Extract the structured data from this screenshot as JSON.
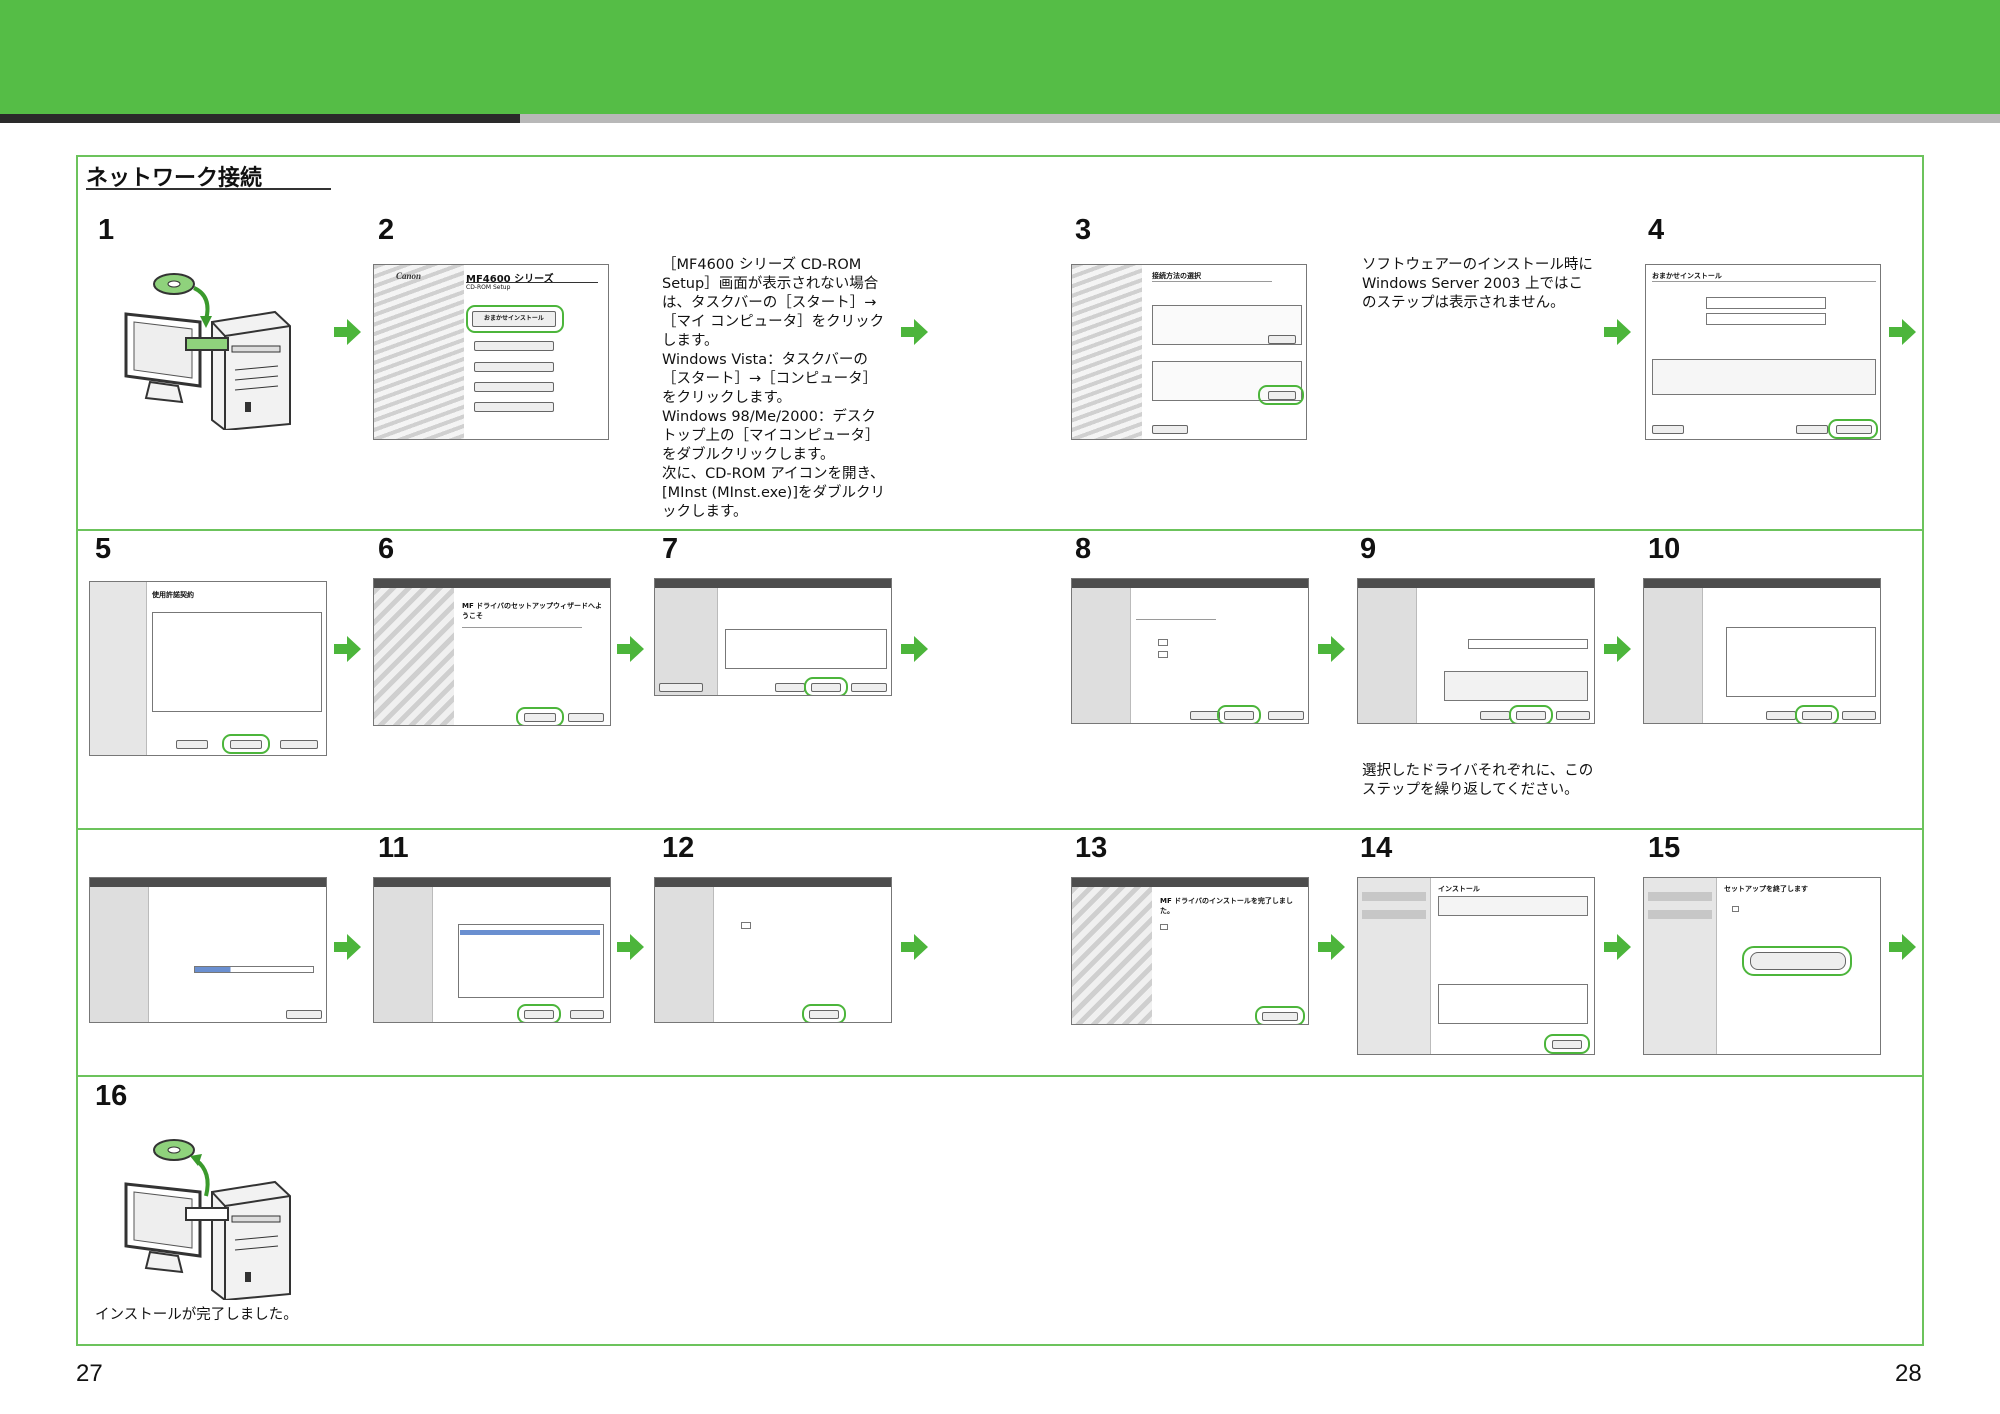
{
  "header": {
    "accent_color": "#55bd46",
    "frame_color": "#6cc35c"
  },
  "section": {
    "title": "ネットワーク接続"
  },
  "steps": [
    {
      "number": "1"
    },
    {
      "number": "2"
    },
    {
      "number": "3"
    },
    {
      "number": "4"
    },
    {
      "number": "5"
    },
    {
      "number": "6"
    },
    {
      "number": "7"
    },
    {
      "number": "8"
    },
    {
      "number": "9"
    },
    {
      "number": "10"
    },
    {
      "number": "11"
    },
    {
      "number": "12"
    },
    {
      "number": "13"
    },
    {
      "number": "14"
    },
    {
      "number": "15"
    },
    {
      "number": "16"
    }
  ],
  "notes": {
    "step2": "［MF4600 シリーズ CD-ROM Setup］画面が表示されない場合は、タスクバーの［スタート］→［マイ コンピュータ］をクリックします。\nWindows Vista：タスクバーの［スタート］→［コンピュータ］をクリックします。\nWindows 98/Me/2000：デスクトップ上の［マイコンピュータ］をダブルクリックします。\n次に、CD-ROM アイコンを開き、[MInst (MInst.exe)]をダブルクリックします。",
    "step3": "ソフトウェアーのインストール時に Windows Server 2003 上ではこのステップは表示されません。",
    "step9": "選択したドライバそれぞれに、このステップを繰り返してください。",
    "step16": "インストールが完了しました。"
  },
  "screens": {
    "step2": {
      "brand": "Canon",
      "title": "MF4600 シリーズ",
      "subtitle": "CD-ROM Setup",
      "main_button": "おまかせインストール"
    },
    "step3": {
      "title": "接続方法の選択"
    },
    "step4": {
      "title": "おまかせインストール"
    },
    "step5": {
      "title": "使用許諾契約"
    },
    "step6": {
      "title": "MF ドライバのセットアップウィザードへようこそ"
    },
    "step13": {
      "title": "MF ドライバのインストールを完了しました。"
    },
    "step14": {
      "title": "インストール"
    },
    "step15": {
      "title": "セットアップを終了します"
    }
  },
  "footer": {
    "page_left": "27",
    "page_right": "28"
  },
  "icons": {
    "arrow": "arrow-right-icon",
    "cd": "cd-disc-icon",
    "computer": "computer-icon"
  }
}
